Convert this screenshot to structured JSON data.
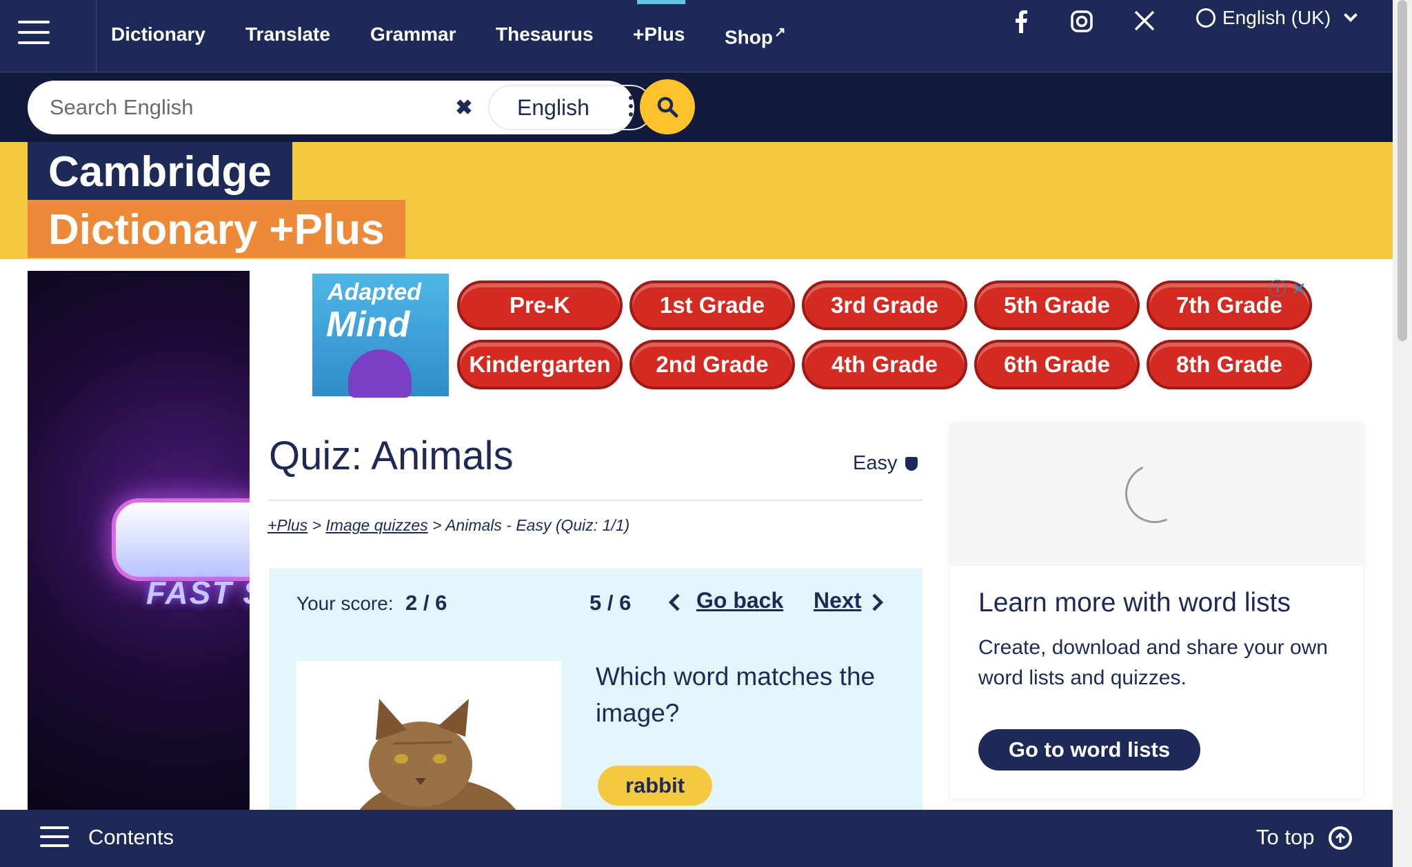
{
  "header": {
    "nav": [
      "Dictionary",
      "Translate",
      "Grammar",
      "Thesaurus",
      "+Plus",
      "Shop"
    ],
    "shop_ext_icon": "↗",
    "language": "English (UK)",
    "social_icons": [
      "facebook-icon",
      "instagram-icon",
      "x-icon"
    ]
  },
  "search": {
    "placeholder": "Search English",
    "clear": "✖",
    "dataset": "English"
  },
  "brand": {
    "line1": "Cambridge",
    "line2": "Dictionary +Plus"
  },
  "ad": {
    "logo_line1": "Adapted",
    "logo_line2": "Mind",
    "grades_row1": [
      "Pre-K",
      "1st Grade",
      "3rd Grade",
      "5th Grade",
      "7th Grade"
    ],
    "grades_row2": [
      "Kindergarten",
      "2nd Grade",
      "4th Grade",
      "6th Grade",
      "8th Grade"
    ],
    "info": "ⓘ ✕"
  },
  "left_ad": {
    "text": "FAST S"
  },
  "quiz": {
    "title": "Quiz: Animals",
    "difficulty": "Easy",
    "breadcrumb": {
      "link1": "+Plus",
      "sep1": " > ",
      "link2": "Image quizzes",
      "rest": " > Animals - Easy (Quiz: 1/1)"
    },
    "score_label": "Your score:",
    "score_value": "2 / 6",
    "progress": "5 / 6",
    "go_back": "Go back",
    "next": "Next",
    "question": "Which word matches the image?",
    "answer": "rabbit"
  },
  "sidebar": {
    "title": "Learn more with word lists",
    "body": "Create, download and share your own word lists and quizzes.",
    "button": "Go to word lists"
  },
  "footer_bar": {
    "contents": "Contents",
    "to_top": "To top"
  },
  "colors": {
    "navy": "#1d2a57",
    "yellow": "#f5c842",
    "orange": "#ec8a3a",
    "light_blue": "#e3f6fc",
    "ad_red": "#d32a21"
  }
}
